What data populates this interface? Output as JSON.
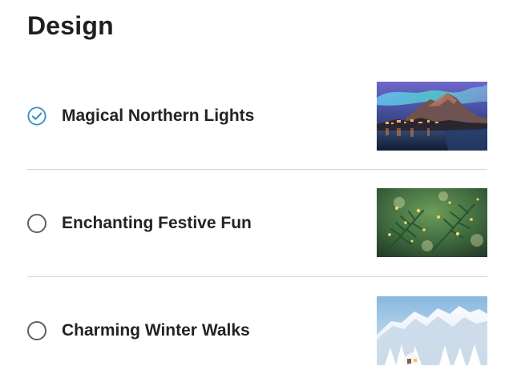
{
  "section": {
    "title": "Design"
  },
  "options": [
    {
      "label": "Magical Northern Lights",
      "selected": true,
      "image": "northern-lights-village-image"
    },
    {
      "label": "Enchanting Festive Fun",
      "selected": false,
      "image": "festive-pine-lights-image"
    },
    {
      "label": "Charming Winter Walks",
      "selected": false,
      "image": "snowy-mountain-forest-image"
    }
  ],
  "colors": {
    "selected_accent": "#2f8fc5",
    "unselected_ring": "#5f5f5f",
    "divider": "#d6d6d6",
    "text": "#232323"
  }
}
